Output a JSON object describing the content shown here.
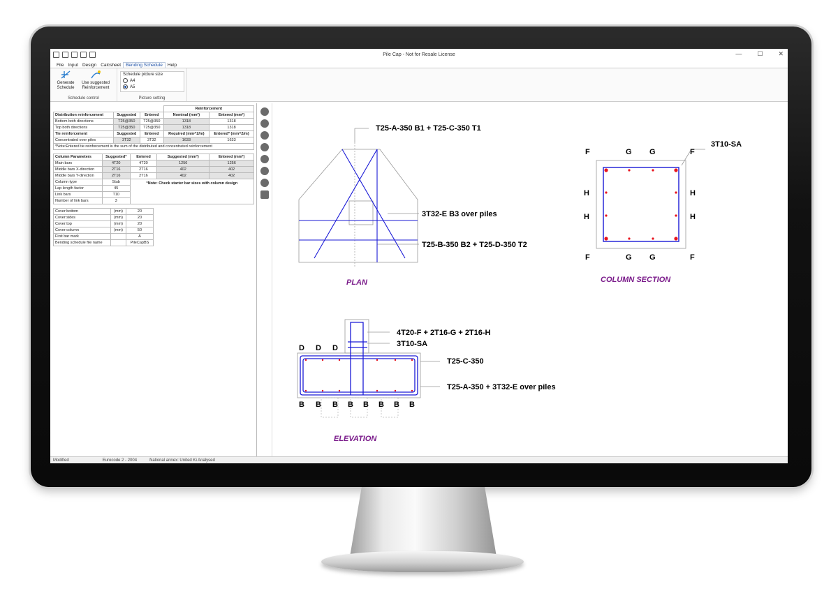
{
  "window": {
    "title": "Pile Cap - Not for Resale License",
    "min": "—",
    "max": "☐",
    "close": "✕"
  },
  "menu": [
    "File",
    "Input",
    "Design",
    "Calcsheet",
    "Bending Schedule",
    "Help"
  ],
  "ribbon": {
    "generate": [
      "Generate",
      "Schedule"
    ],
    "use_suggested": [
      "Use suggested",
      "Reinforcement"
    ],
    "schedule_control": "Schedule control",
    "picture_size_label": "Schedule picture size",
    "a4": "A4",
    "a5": "A5",
    "picture_setting": "Picture setting"
  },
  "table1": {
    "reinf_header": "Reinforcement",
    "distribution": "Distribution reinforcement",
    "suggested": "Suggested",
    "entered": "Entered",
    "nominal": "Nominal (mm²)",
    "entered_mm": "Entered (mm²)",
    "rows1": [
      [
        "Bottom both directions",
        "T25@350",
        "T25@350",
        "1318",
        "1318"
      ],
      [
        "Top both directions",
        "T25@350",
        "T25@350",
        "1318",
        "1318"
      ]
    ],
    "tie": "Tie reinforcement",
    "required": "Required (mm^2/m)",
    "entered_star": "Entered* (mm^2/m)",
    "rows2": [
      [
        "Concentrated over piles",
        "3T32",
        "3T32",
        "1633",
        "1633"
      ]
    ],
    "note": "*Note:Entered tie reinforcement is the sum of the distributed and concentrated reinforcement"
  },
  "table2": {
    "col_params": "Column Parameters",
    "suggested": "Suggested*",
    "entered": "Entered",
    "sug_mm": "Suggested (mm²)",
    "ent_mm": "Entered (mm²)",
    "rows": [
      [
        "Main bars",
        "4T20",
        "4T20",
        "1256",
        "1256"
      ],
      [
        "Middle bars X-direction",
        "2T16",
        "2T16",
        "402",
        "402"
      ],
      [
        "Middle bars Y-direction",
        "2T16",
        "2T16",
        "402",
        "402"
      ]
    ],
    "params": [
      [
        "Column type",
        "Stub"
      ],
      [
        "Lap length factor",
        "45"
      ],
      [
        "Link bars",
        "T10"
      ],
      [
        "Number of link bars",
        "3"
      ]
    ],
    "note": "*Note: Check starter bar sizes with column design"
  },
  "table3": {
    "rows": [
      [
        "Cover:bottom",
        "(mm)",
        "20"
      ],
      [
        "Cover:sides",
        "(mm)",
        "20"
      ],
      [
        "Cover:top",
        "(mm)",
        "20"
      ],
      [
        "Cover:column",
        "(mm)",
        "50"
      ],
      [
        "First bar mark",
        "",
        "A"
      ],
      [
        "Bending schedule file name",
        "",
        "PileCapBS"
      ]
    ]
  },
  "drawing": {
    "plan_top": "T25-A-350 B1 + T25-C-350 T1",
    "plan_mid": "3T32-E B3 over piles",
    "plan_bot": "T25-B-350 B2 + T25-D-350 T2",
    "plan_title": "PLAN",
    "col_label": "3T10-SA",
    "col_title": "COLUMN SECTION",
    "F": "F",
    "G": "G",
    "H": "H",
    "D": "D",
    "B": "B",
    "elev_1": "4T20-F + 2T16-G + 2T16-H",
    "elev_2": "3T10-SA",
    "elev_3": "T25-C-350",
    "elev_4": "T25-A-350 + 3T32-E over piles",
    "elev_title": "ELEVATION"
  },
  "status": {
    "state": "Modified",
    "code": "Eurocode 2 - 2004",
    "annex": "National annex: United Ki Analysed"
  },
  "colors": {
    "bar": "#1a1ad6",
    "accent": "#7a1a8a",
    "dot": "#e8141e"
  }
}
